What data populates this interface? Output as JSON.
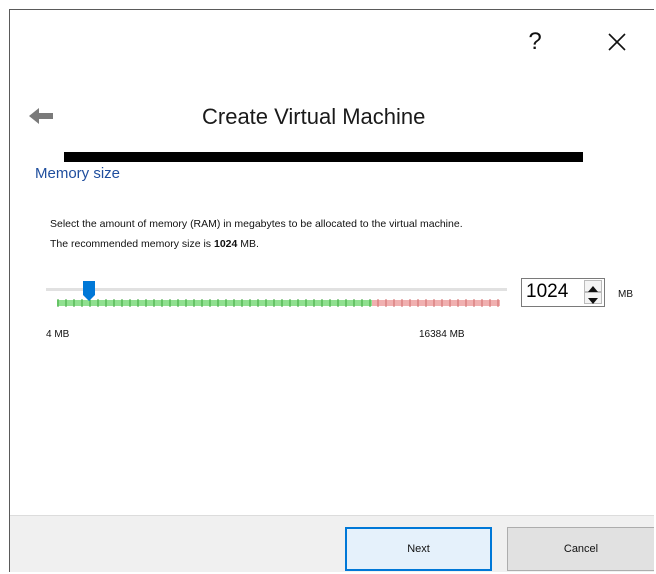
{
  "window": {
    "help_label": "?",
    "title": "Create Virtual Machine"
  },
  "icons": {
    "back": "back-arrow-icon",
    "close": "close-icon",
    "spin_up": "chevron-up-icon",
    "spin_down": "chevron-down-icon"
  },
  "section": {
    "title": "Memory size",
    "description_1": "Select the amount of memory (RAM) in megabytes to be allocated to the virtual machine.",
    "description_2_prefix": "The recommended memory size is ",
    "description_2_value": "1024",
    "description_2_suffix": " MB."
  },
  "memory": {
    "min_label": "4 MB",
    "max_label": "16384 MB",
    "value": "1024",
    "unit": "MB",
    "min": 4,
    "max": 16384,
    "slider_value": 1024,
    "safe_fraction": 0.71
  },
  "colors": {
    "accent": "#0078d7",
    "section_title": "#1f4e9e",
    "safe_range": "#90e090",
    "warn_range": "#f0b0b0"
  },
  "footer": {
    "next_label": "Next",
    "cancel_label": "Cancel"
  }
}
